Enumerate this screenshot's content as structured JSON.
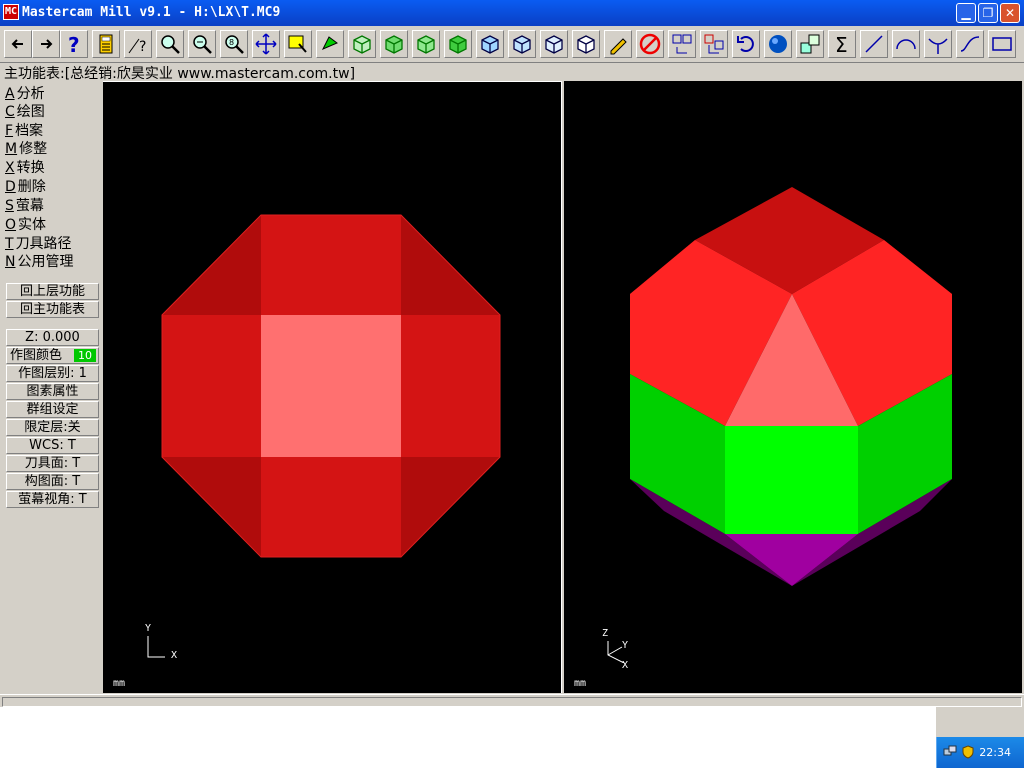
{
  "window": {
    "title": "Mastercam Mill v9.1 - H:\\LX\\T.MC9",
    "app_icon": "MC",
    "buttons": [
      "minimize-icon",
      "restore-icon",
      "close-icon"
    ]
  },
  "toolbar": {
    "icons": [
      "arrow-left-icon",
      "arrow-right-icon",
      "help-icon",
      "calculator-icon",
      "analyze-question-icon",
      "zoom-window-icon",
      "zoom-out-icon",
      "zoom-fit-icon",
      "pan-icon",
      "select-window-icon",
      "rotate-icon",
      "view-top-icon",
      "view-front-icon",
      "view-side-icon",
      "view-iso-icon",
      "cube-1-icon",
      "cube-2-icon",
      "cube-3-icon",
      "cube-4-icon",
      "pencil-icon",
      "no-draw-icon",
      "translate-icon",
      "transform-icon",
      "undo-icon",
      "sphere-icon",
      "group-icon",
      "sigma-icon",
      "line-icon",
      "arc-icon",
      "trim-icon",
      "spline-icon",
      "rectangle-icon"
    ]
  },
  "menu": {
    "title": "主功能表:[总经销:欣昊实业 www.mastercam.com.tw]",
    "items": [
      {
        "key": "A",
        "label": "分析"
      },
      {
        "key": "C",
        "label": "绘图"
      },
      {
        "key": "F",
        "label": "档案"
      },
      {
        "key": "M",
        "label": "修整"
      },
      {
        "key": "X",
        "label": "转换"
      },
      {
        "key": "D",
        "label": "删除"
      },
      {
        "key": "S",
        "label": "萤幕"
      },
      {
        "key": "O",
        "label": "实体"
      },
      {
        "key": "T",
        "label": "刀具路径"
      },
      {
        "key": "N",
        "label": "公用管理"
      }
    ],
    "back_prev": "回上层功能",
    "back_main": "回主功能表"
  },
  "settings": {
    "z": "Z:  0.000",
    "color_label": "作图颜色",
    "color_value": "10",
    "level": "作图层别: 1",
    "attributes": "图素属性",
    "group": "群组设定",
    "mask": "限定层:关",
    "wcs": "WCS:  T",
    "tool_plane": "刀具面: T",
    "construct_plane": "构图面: T",
    "screen_view": "萤幕视角: T"
  },
  "viewports": {
    "left": {
      "unit": "mm",
      "axis_y": "Y",
      "axis_x": "X"
    },
    "right": {
      "unit": "mm",
      "axis_z": "Z",
      "axis_y": "Y",
      "axis_x": "X"
    }
  },
  "taskbar": {
    "clock": "22:34",
    "icons": [
      "network-icon",
      "security-shield-icon"
    ]
  },
  "colors": {
    "titlebar": "#0a4fd8",
    "face_red": "#d41414",
    "face_dark_red": "#a00000",
    "face_light_red": "#ff6a6a",
    "face_green": "#00e600",
    "face_purple": "#8a008a"
  }
}
